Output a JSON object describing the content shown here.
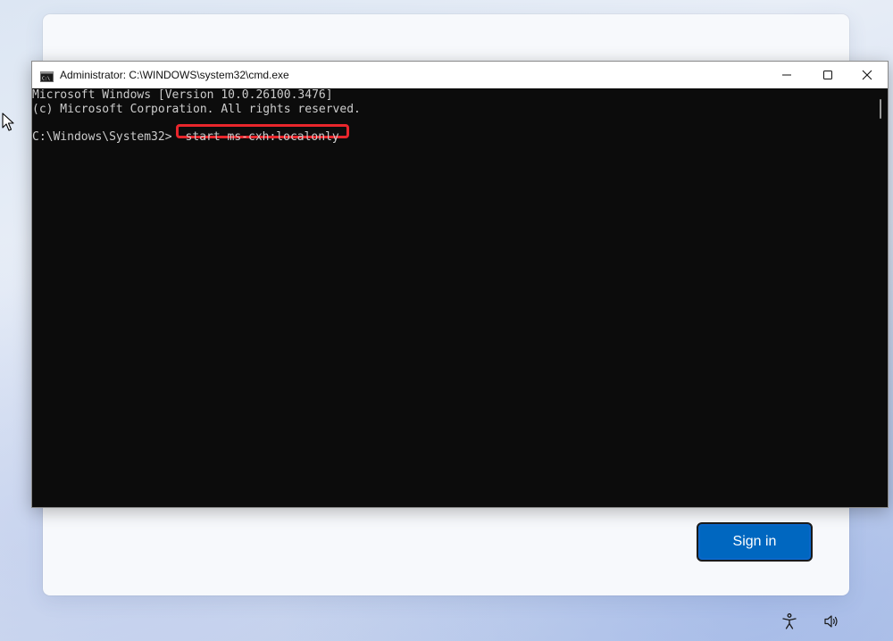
{
  "oobe": {
    "signin_label": "Sign in"
  },
  "cmd": {
    "title": "Administrator: C:\\WINDOWS\\system32\\cmd.exe",
    "icon": "cmd-icon",
    "lines": [
      "Microsoft Windows [Version 10.0.26100.3476]",
      "(c) Microsoft Corporation. All rights reserved."
    ],
    "prompt": "C:\\Windows\\System32>",
    "command": "start ms-cxh:localonly",
    "highlight_color": "#e8262c",
    "background_color": "#0c0c0c",
    "text_color": "#cccccc"
  },
  "tray": {
    "icons": [
      "accessibility-icon",
      "volume-icon"
    ]
  },
  "colors": {
    "accent": "#0067c0"
  }
}
